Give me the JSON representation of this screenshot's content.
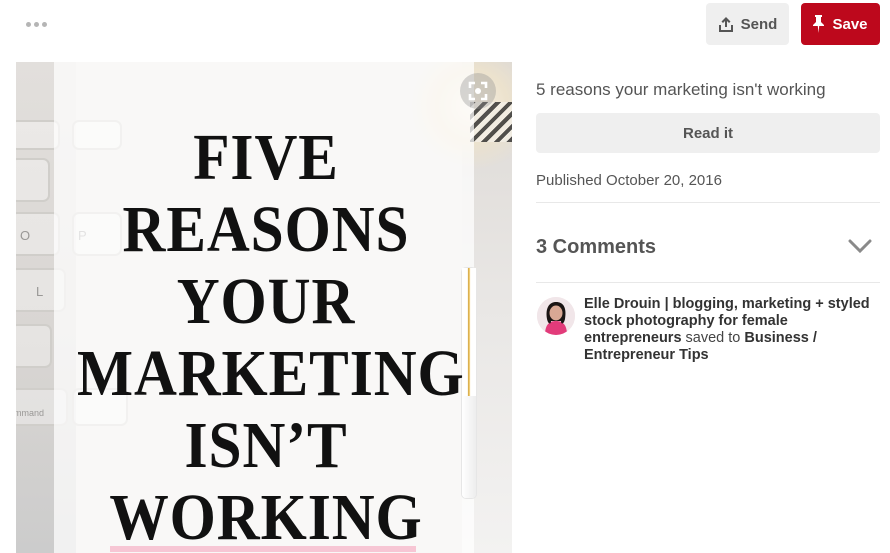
{
  "header": {
    "more_icon": "ellipsis-icon",
    "send_label": "Send",
    "send_icon": "share-icon",
    "save_label": "Save",
    "save_icon": "pushpin-icon",
    "save_color": "#bd081c"
  },
  "pin_image": {
    "title_lines": [
      "FIVE",
      "REASONS",
      "YOUR",
      "MARKETING",
      "ISN’T",
      "WORKING"
    ],
    "keyboard_keys": [
      "O",
      "P",
      "L"
    ],
    "keyboard_word": "mmand",
    "lens_icon": "visual-search-icon"
  },
  "details": {
    "description": "5 reasons your marketing isn't working",
    "read_it_label": "Read it",
    "published": "Published October 20, 2016"
  },
  "comments": {
    "header": "3 Comments",
    "toggle_icon": "chevron-down-icon"
  },
  "attribution": {
    "user_name": "Elle Drouin | blogging, marketing + styled stock photography for female entrepreneurs",
    "saved_to_text": " saved to ",
    "board_name": "Business / Entrepreneur Tips"
  }
}
